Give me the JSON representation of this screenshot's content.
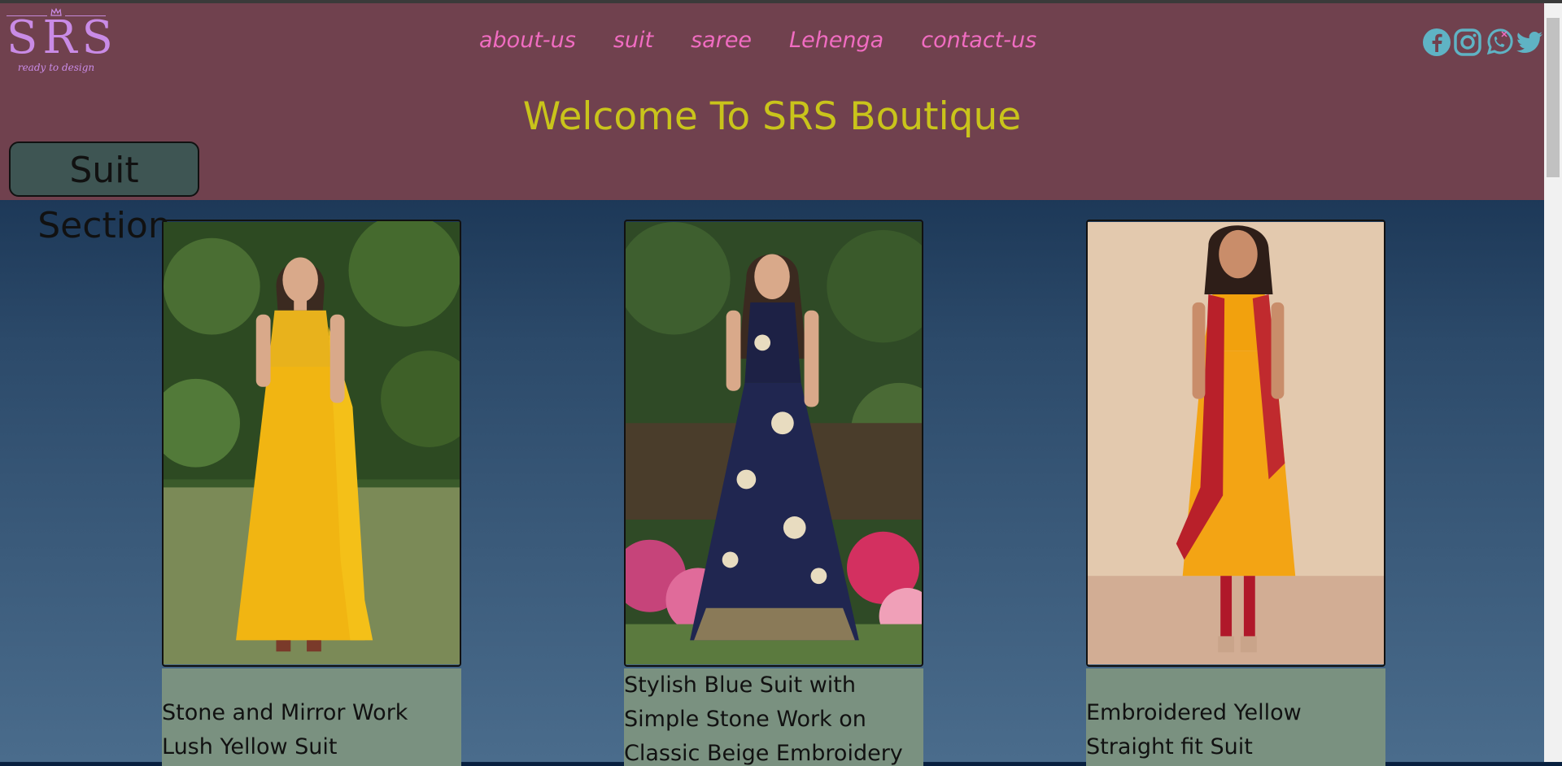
{
  "logo": {
    "text": "SRS",
    "tagline": "ready to design"
  },
  "nav": [
    {
      "label": "about-us"
    },
    {
      "label": "suit"
    },
    {
      "label": "saree"
    },
    {
      "label": "Lehenga"
    },
    {
      "label": "contact-us"
    }
  ],
  "social": [
    "facebook-icon",
    "instagram-icon",
    "whatsapp-icon",
    "twitter-icon"
  ],
  "welcome": "Welcome To SRS Boutique",
  "section_button": "Suit Section",
  "products": [
    {
      "caption": "Stone and Mirror Work Lush Yellow Suit"
    },
    {
      "caption": "Stylish Blue Suit with Simple Stone Work on Classic Beige Embroidery"
    },
    {
      "caption": "Embroidered Yellow Straight fit Suit"
    }
  ]
}
